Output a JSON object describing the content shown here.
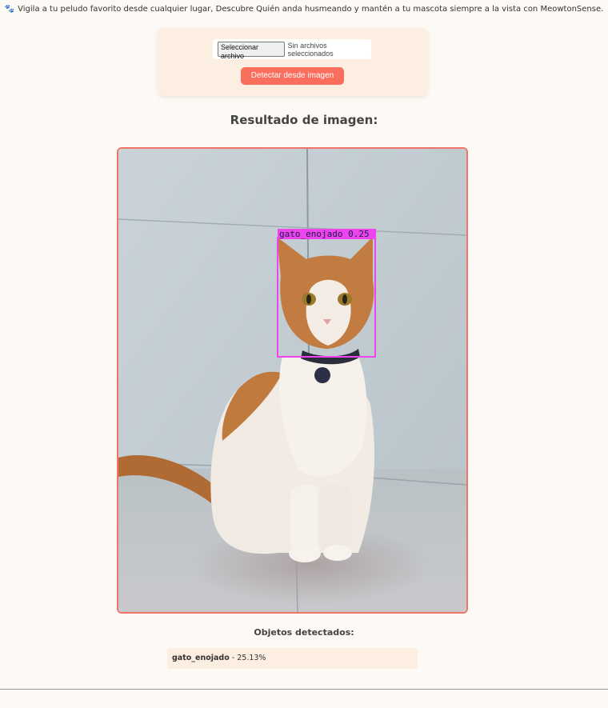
{
  "header": {
    "tagline": "Vigila a tu peludo favorito desde cualquier lugar, Descubre Quién anda husmeando y mantén a tu mascota siempre a la vista con MeowtonSense.",
    "tagline_icon": "paw-icon"
  },
  "upload": {
    "file_button_label": "Seleccionar archivo",
    "file_status": "Sin archivos seleccionados",
    "detect_button_label": "Detectar desde imagen"
  },
  "result": {
    "title": "Resultado de imagen:",
    "box_label": "gato_enojado  0.25",
    "box_color": "#ee44ee"
  },
  "detections": {
    "title": "Objetos detectados:",
    "items": [
      {
        "label": "gato_enojado",
        "separator": " - ",
        "confidence": "25.13%"
      }
    ]
  },
  "colors": {
    "accent": "#fa6e5e",
    "frame": "#f07468",
    "card": "#fdeee2",
    "background": "#fdf9f4"
  }
}
